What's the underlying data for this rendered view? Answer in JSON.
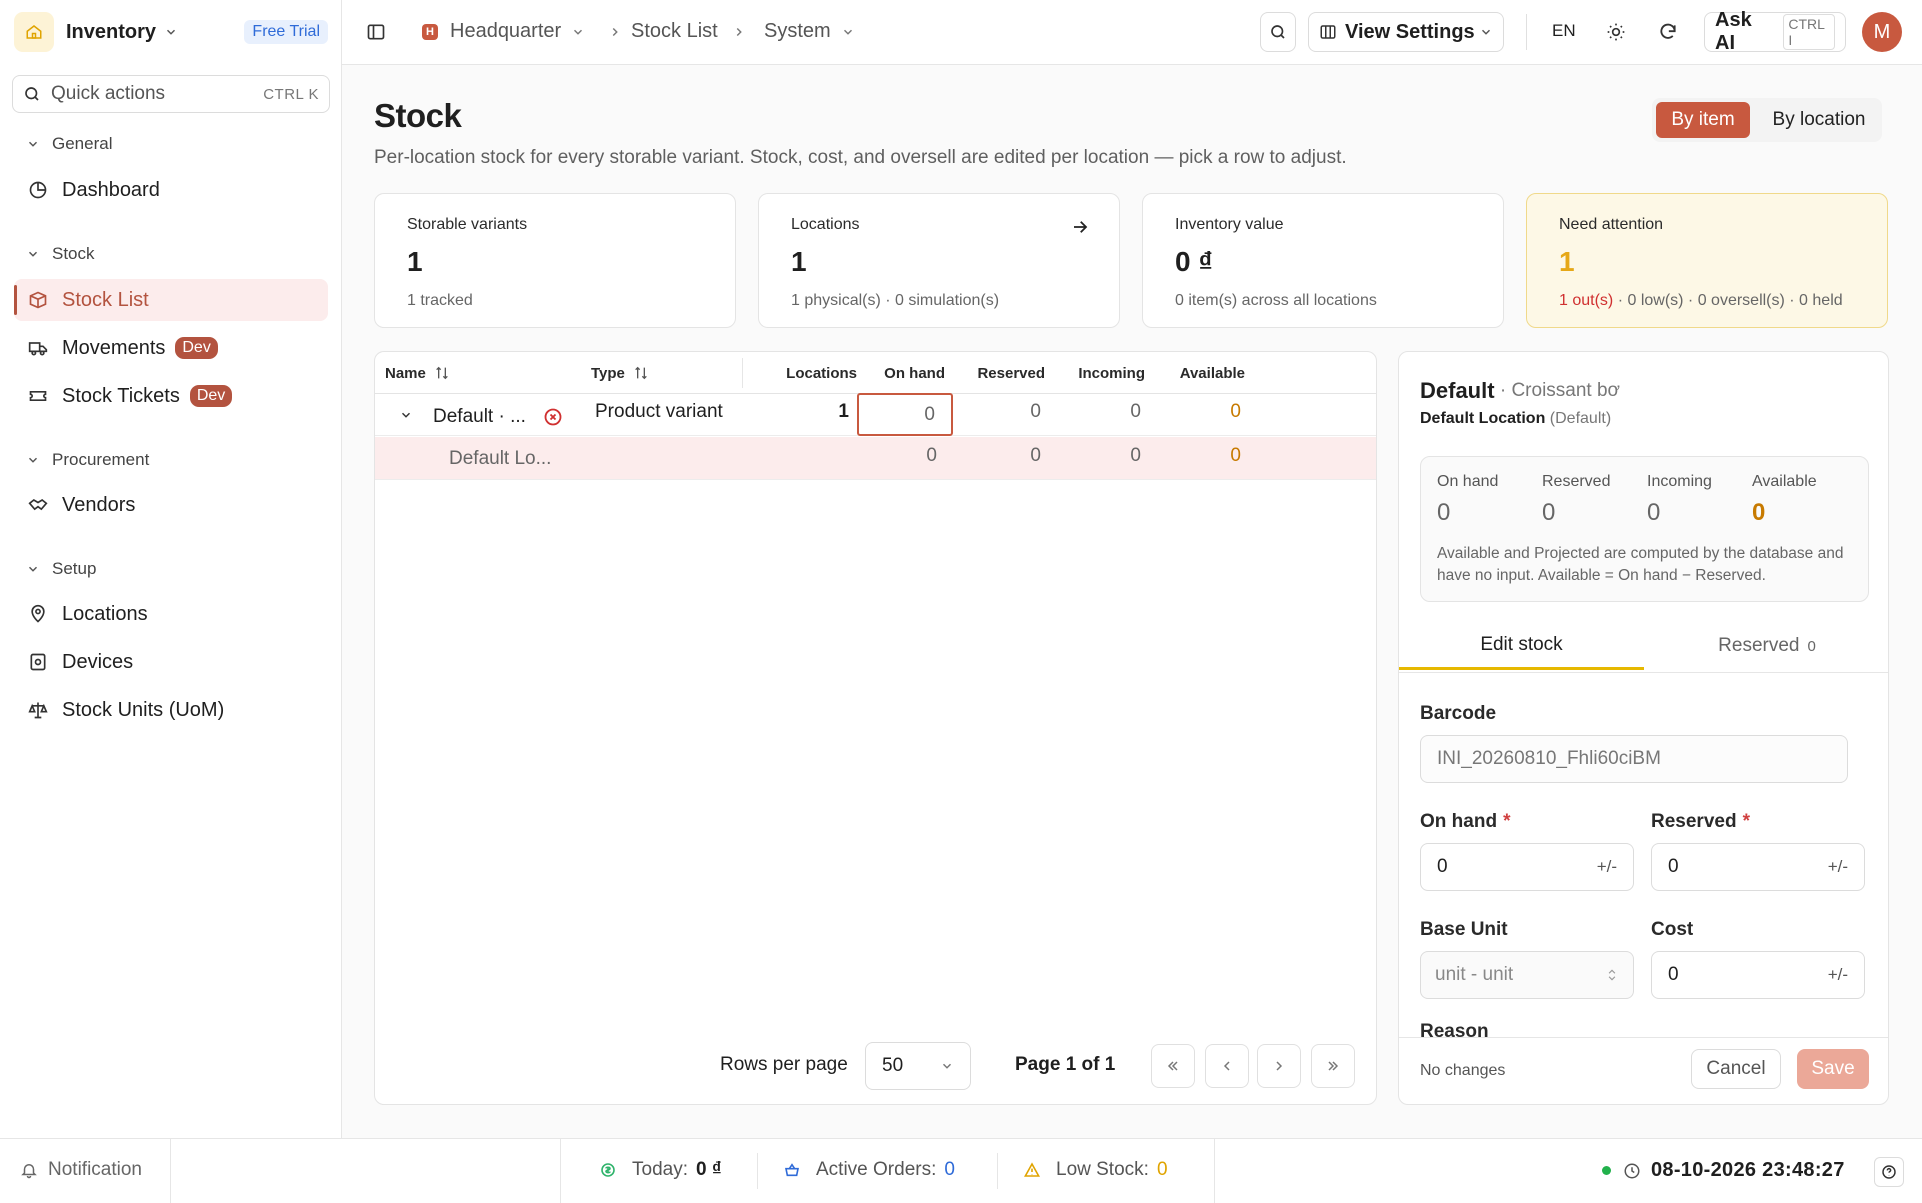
{
  "app": {
    "name": "Inventory",
    "trial_badge": "Free Trial",
    "avatar_initial": "M",
    "accent": "#c8593f"
  },
  "search": {
    "placeholder": "Quick actions",
    "shortcut": "CTRL K"
  },
  "sidebar": {
    "sections": [
      {
        "title": "General",
        "items": [
          {
            "label": "Dashboard",
            "icon": "dashboard-icon"
          }
        ]
      },
      {
        "title": "Stock",
        "items": [
          {
            "label": "Stock List",
            "icon": "box-icon",
            "active": true
          },
          {
            "label": "Movements",
            "icon": "truck-icon",
            "badge": "Dev"
          },
          {
            "label": "Stock Tickets",
            "icon": "ticket-icon",
            "badge": "Dev"
          }
        ]
      },
      {
        "title": "Procurement",
        "items": [
          {
            "label": "Vendors",
            "icon": "handshake-icon"
          }
        ]
      },
      {
        "title": "Setup",
        "items": [
          {
            "label": "Locations",
            "icon": "location-icon"
          },
          {
            "label": "Devices",
            "icon": "device-icon"
          },
          {
            "label": "Stock Units (UoM)",
            "icon": "scale-icon"
          }
        ]
      }
    ]
  },
  "topbar": {
    "breadcrumb": [
      {
        "label": "Headquarter",
        "badge": "H"
      },
      {
        "label": "Stock List"
      },
      {
        "label": "System"
      }
    ],
    "view_settings": "View Settings",
    "language": "EN",
    "ask_ai": "Ask AI",
    "ask_ai_shortcut": "CTRL I"
  },
  "page": {
    "title": "Stock",
    "subtitle": "Per-location stock for every storable variant. Stock, cost, and oversell are edited per location — pick a row to adjust.",
    "toggle": [
      "By item",
      "By location"
    ]
  },
  "cards": [
    {
      "title": "Storable variants",
      "value": "1",
      "sub": "1 tracked"
    },
    {
      "title": "Locations",
      "value": "1",
      "sub": "1 physical(s) · 0 simulation(s)"
    },
    {
      "title": "Inventory value",
      "value": "0 ₫",
      "sub": "0 item(s) across all locations"
    },
    {
      "title": "Need attention",
      "value": "1",
      "sub_out": "1 out(s)",
      "sub_rest": " · 0 low(s) · 0 oversell(s) · 0 held"
    }
  ],
  "table": {
    "columns": [
      "Name",
      "Type",
      "Locations",
      "On hand",
      "Reserved",
      "Incoming",
      "Available"
    ],
    "rows": [
      {
        "name": "Default · ...",
        "type": "Product variant",
        "locations": "1",
        "on_hand": "0",
        "reserved": "0",
        "incoming": "0",
        "available": "0"
      },
      {
        "name": "Default Lo...",
        "type": "",
        "locations": "",
        "on_hand": "0",
        "reserved": "0",
        "incoming": "0",
        "available": "0"
      }
    ],
    "rows_per_page_label": "Rows per page",
    "rows_per_page": "50",
    "page_label": "Page 1 of 1"
  },
  "panel": {
    "title": "Default",
    "title_suffix": " · Croissant bơ",
    "location": "Default Location",
    "location_suffix": " (Default)",
    "stats": [
      {
        "label": "On hand",
        "value": "0"
      },
      {
        "label": "Reserved",
        "value": "0"
      },
      {
        "label": "Incoming",
        "value": "0"
      },
      {
        "label": "Available",
        "value": "0"
      }
    ],
    "note": "Available and Projected are computed by the database and have no input. Available = On hand − Reserved.",
    "tabs": [
      {
        "label": "Edit stock"
      },
      {
        "label": "Reserved",
        "count": "0"
      }
    ],
    "barcode_label": "Barcode",
    "barcode_value": "INI_20260810_Fhli60ciBM",
    "on_hand_label": "On hand",
    "on_hand_value": "0",
    "reserved_label": "Reserved",
    "reserved_value": "0",
    "base_unit_label": "Base Unit",
    "base_unit_value": "unit - unit",
    "cost_label": "Cost",
    "cost_value": "0",
    "adjust_symbol": "+/-",
    "reason_label": "Reason",
    "status": "No changes",
    "cancel": "Cancel",
    "save": "Save"
  },
  "footer": {
    "notification": "Notification",
    "today_label": "Today:",
    "today_value": "0 ₫",
    "orders_label": "Active Orders:",
    "orders_value": "0",
    "low_label": "Low Stock:",
    "low_value": "0",
    "datetime": "08-10-2026 23:48:27"
  }
}
